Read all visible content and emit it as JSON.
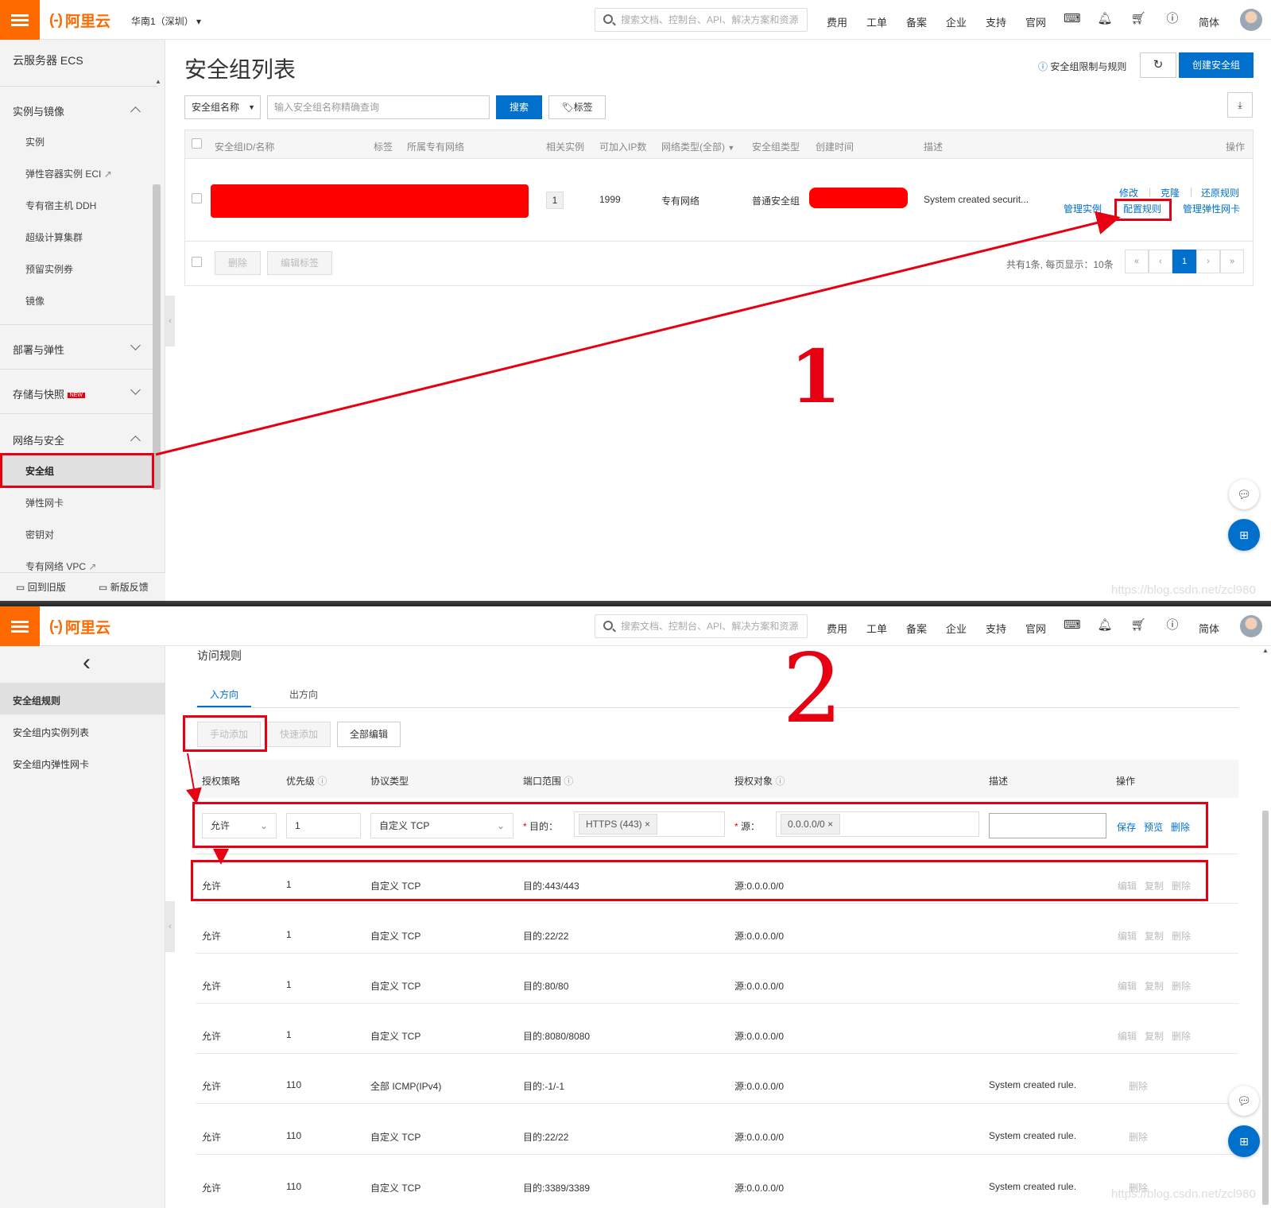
{
  "header": {
    "logo_mark": "(-)",
    "logo_text": "阿里云",
    "region": "华南1（深圳）",
    "search_placeholder": "搜索文档、控制台、API、解决方案和资源",
    "nav": [
      "费用",
      "工单",
      "备案",
      "企业",
      "支持",
      "官网"
    ],
    "lang": "简体"
  },
  "top": {
    "sidebar": {
      "title": "云服务器 ECS",
      "sections": [
        {
          "label": "实例与镜像",
          "items": [
            "实例",
            "弹性容器实例 ECI",
            "专有宿主机 DDH",
            "超级计算集群",
            "预留实例券",
            "镜像"
          ]
        },
        {
          "label": "部署与弹性"
        },
        {
          "label": "存储与快照",
          "badge": "NEW"
        },
        {
          "label": "网络与安全",
          "items": [
            "安全组",
            "弹性网卡",
            "密钥对",
            "专有网络 VPC"
          ]
        }
      ],
      "footer_old": "回到旧版",
      "footer_feedback": "新版反馈"
    },
    "page_title": "安全组列表",
    "limits_link": "安全组限制与规则",
    "create_button": "创建安全组",
    "filter_select": "安全组名称",
    "search_placeholder": "输入安全组名称精确查询",
    "search_button": "搜索",
    "tag_button": "标签",
    "table": {
      "headers": [
        "安全组ID/名称",
        "标签",
        "所属专有网络",
        "相关实例",
        "可加入IP数",
        "网络类型(全部)",
        "安全组类型",
        "创建时间",
        "描述",
        "操作"
      ],
      "row": {
        "instances": "1",
        "ip_count": "1999",
        "network_type": "专有网络",
        "sg_type": "普通安全组",
        "description": "System created securit...",
        "actions": [
          "修改",
          "克隆",
          "还原规则",
          "管理实例",
          "配置规则",
          "管理弹性网卡"
        ]
      }
    },
    "delete_button": "删除",
    "edit_tags_button": "编辑标签",
    "pagination": {
      "summary": "共有1条, 每页显示：10条",
      "current": "1",
      "first": "«",
      "prev": "‹",
      "next": "›",
      "last": "»"
    },
    "annotation": "1",
    "watermark": "https://blog.csdn.net/zcl980"
  },
  "bottom": {
    "back": "‹",
    "sidebar": [
      "安全组规则",
      "安全组内实例列表",
      "安全组内弹性网卡"
    ],
    "section_title": "访问规则",
    "tabs": [
      "入方向",
      "出方向"
    ],
    "buttons": [
      "手动添加",
      "快速添加",
      "全部编辑"
    ],
    "annotation": "2",
    "headers": [
      "授权策略",
      "优先级",
      "协议类型",
      "端口范围",
      "授权对象",
      "描述",
      "操作"
    ],
    "edit_row": {
      "policy": "允许",
      "priority": "1",
      "protocol": "自定义 TCP",
      "dest_label": "目的：",
      "dest_tag": "HTTPS (443)",
      "src_label": "源：",
      "src_tag": "0.0.0.0/0",
      "actions": [
        "保存",
        "预览",
        "删除"
      ]
    },
    "rows": [
      {
        "policy": "允许",
        "priority": "1",
        "protocol": "自定义 TCP",
        "port": "目的:443/443",
        "src": "源:0.0.0.0/0",
        "desc": "",
        "actions": [
          "编辑",
          "复制",
          "删除"
        ]
      },
      {
        "policy": "允许",
        "priority": "1",
        "protocol": "自定义 TCP",
        "port": "目的:22/22",
        "src": "源:0.0.0.0/0",
        "desc": "",
        "actions": [
          "编辑",
          "复制",
          "删除"
        ]
      },
      {
        "policy": "允许",
        "priority": "1",
        "protocol": "自定义 TCP",
        "port": "目的:80/80",
        "src": "源:0.0.0.0/0",
        "desc": "",
        "actions": [
          "编辑",
          "复制",
          "删除"
        ]
      },
      {
        "policy": "允许",
        "priority": "1",
        "protocol": "自定义 TCP",
        "port": "目的:8080/8080",
        "src": "源:0.0.0.0/0",
        "desc": "",
        "actions": [
          "编辑",
          "复制",
          "删除"
        ]
      },
      {
        "policy": "允许",
        "priority": "110",
        "protocol": "全部 ICMP(IPv4)",
        "port": "目的:-1/-1",
        "src": "源:0.0.0.0/0",
        "desc": "System created rule.",
        "actions": [
          "删除"
        ]
      },
      {
        "policy": "允许",
        "priority": "110",
        "protocol": "自定义 TCP",
        "port": "目的:22/22",
        "src": "源:0.0.0.0/0",
        "desc": "System created rule.",
        "actions": [
          "删除"
        ]
      },
      {
        "policy": "允许",
        "priority": "110",
        "protocol": "自定义 TCP",
        "port": "目的:3389/3389",
        "src": "源:0.0.0.0/0",
        "desc": "System created rule.",
        "actions": [
          "删除"
        ]
      }
    ],
    "watermark": "https://blog.csdn.net/zcl980"
  },
  "colors": {
    "brand": "#ff6a00",
    "primary": "#0070cc",
    "annotation": "#e60012"
  }
}
